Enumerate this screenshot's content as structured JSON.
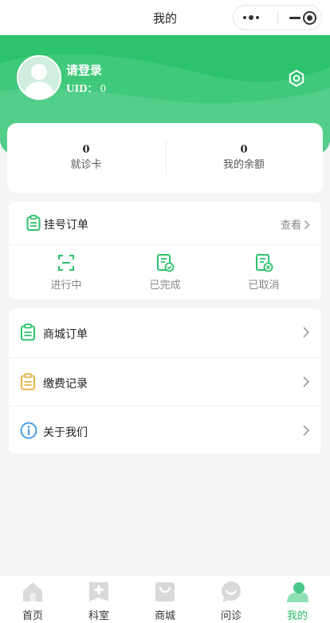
{
  "navbar": {
    "title": "我的"
  },
  "profile": {
    "login_text": "请登录",
    "uid_label": "UID：",
    "uid_value": "0"
  },
  "stats": [
    {
      "value": "0",
      "label": "就诊卡"
    },
    {
      "value": "0",
      "label": "我的余额"
    }
  ],
  "orders": {
    "title": "挂号订单",
    "more_label": "查看",
    "statuses": [
      {
        "label": "进行中",
        "icon": "scan-icon"
      },
      {
        "label": "已完成",
        "icon": "doc-check-icon"
      },
      {
        "label": "已取消",
        "icon": "doc-cancel-icon"
      }
    ]
  },
  "menu": [
    {
      "label": "商城订单",
      "icon": "clipboard-icon"
    },
    {
      "label": "缴费记录",
      "icon": "clipboard-icon"
    },
    {
      "label": "关于我们",
      "icon": "info-icon"
    }
  ],
  "tabbar": [
    {
      "label": "首页",
      "icon": "home-icon",
      "active": false
    },
    {
      "label": "科室",
      "icon": "plus-icon",
      "active": false
    },
    {
      "label": "商城",
      "icon": "bag-icon",
      "active": false
    },
    {
      "label": "问诊",
      "icon": "chat-icon",
      "active": false
    },
    {
      "label": "我的",
      "icon": "user-icon",
      "active": true
    }
  ],
  "colors": {
    "brand_green": "#2dc26c",
    "active_tab": "#27b866",
    "payment_icon": "#e6b54a",
    "info_icon": "#4a9de0"
  }
}
